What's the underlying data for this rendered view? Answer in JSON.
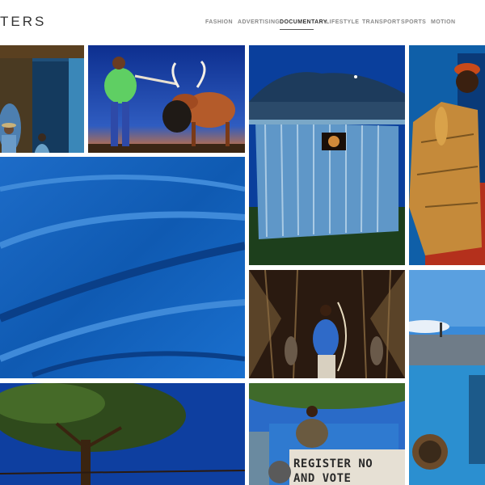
{
  "brand": {
    "logo_text": "TERS"
  },
  "nav": {
    "items": [
      {
        "label": "FASHION"
      },
      {
        "label": "ADVERTISING"
      },
      {
        "label": "DOCUMENTARY",
        "active": true
      },
      {
        "label": "LIFESTYLE"
      },
      {
        "label": "TRANSPORT"
      },
      {
        "label": "SPORTS"
      },
      {
        "label": "MOTION"
      }
    ]
  },
  "gallery": {
    "sign_text_line1": "REGISTER NO",
    "sign_text_line2": "AND VOTE"
  }
}
